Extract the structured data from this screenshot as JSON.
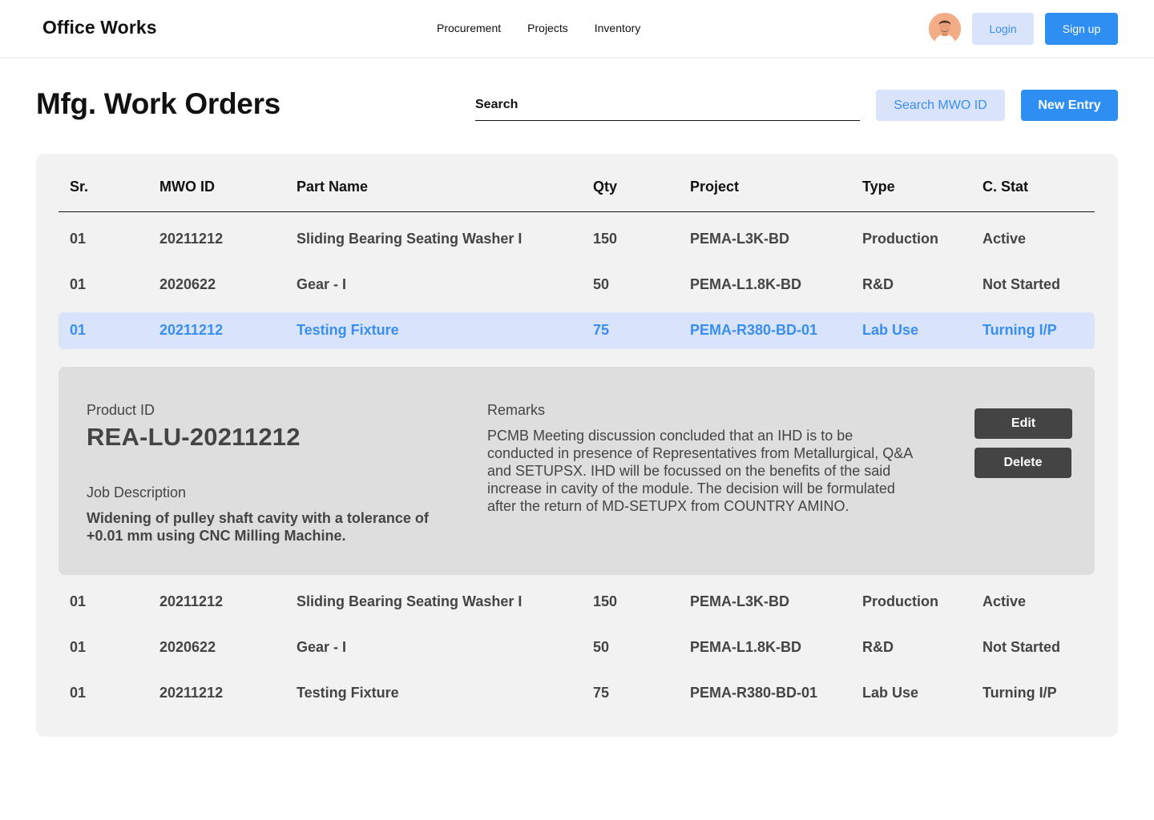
{
  "brand": "Office Works",
  "nav": [
    "Procurement",
    "Projects",
    "Inventory"
  ],
  "auth": {
    "login": "Login",
    "signup": "Sign up"
  },
  "page": {
    "title": "Mfg. Work Orders",
    "search_placeholder": "Search",
    "search_button": "Search MWO ID",
    "new_button": "New Entry"
  },
  "table": {
    "columns": [
      "Sr.",
      "MWO ID",
      "Part Name",
      "Qty",
      "Project",
      "Type",
      "C. Stat"
    ],
    "rows": [
      [
        "01",
        "20211212",
        "Sliding Bearing Seating Washer I",
        "150",
        "PEMA-L3K-BD",
        "Production",
        "Active"
      ],
      [
        "01",
        "2020622",
        "Gear - I",
        "50",
        "PEMA-L1.8K-BD",
        "R&D",
        "Not Started"
      ],
      [
        "01",
        "20211212",
        "Testing Fixture",
        "75",
        "PEMA-R380-BD-01",
        "Lab Use",
        "Turning I/P"
      ],
      [
        "01",
        "20211212",
        "Sliding Bearing Seating Washer I",
        "150",
        "PEMA-L3K-BD",
        "Production",
        "Active"
      ],
      [
        "01",
        "2020622",
        "Gear - I",
        "50",
        "PEMA-L1.8K-BD",
        "R&D",
        "Not Started"
      ],
      [
        "01",
        "20211212",
        "Testing Fixture",
        "75",
        "PEMA-R380-BD-01",
        "Lab Use",
        "Turning I/P"
      ]
    ],
    "selected_row": 2
  },
  "detail": {
    "product_id_label": "Product ID",
    "product_id": "REA-LU-20211212",
    "job_label": "Job Description",
    "job": "Widening of pulley shaft cavity with a tolerance of  +0.01 mm using CNC Milling Machine.",
    "remarks_label": "Remarks",
    "remarks": "PCMB Meeting discussion concluded that an IHD is to be conducted in presence of Representatives from Metallurgical, Q&A  and SETUPSX. IHD will be focussed on the benefits of the said increase in cavity of the module. The decision will be formulated after the return of MD-SETUPX from COUNTRY AMINO.",
    "edit": "Edit",
    "delete": "Delete"
  },
  "colors": {
    "accent": "#2f8ef2",
    "accent_light": "#d9e4fb",
    "panel": "#f2f2f2",
    "detail_bg": "#dedede",
    "dark_button": "#444444"
  },
  "icons": {
    "avatar": "user-avatar"
  }
}
